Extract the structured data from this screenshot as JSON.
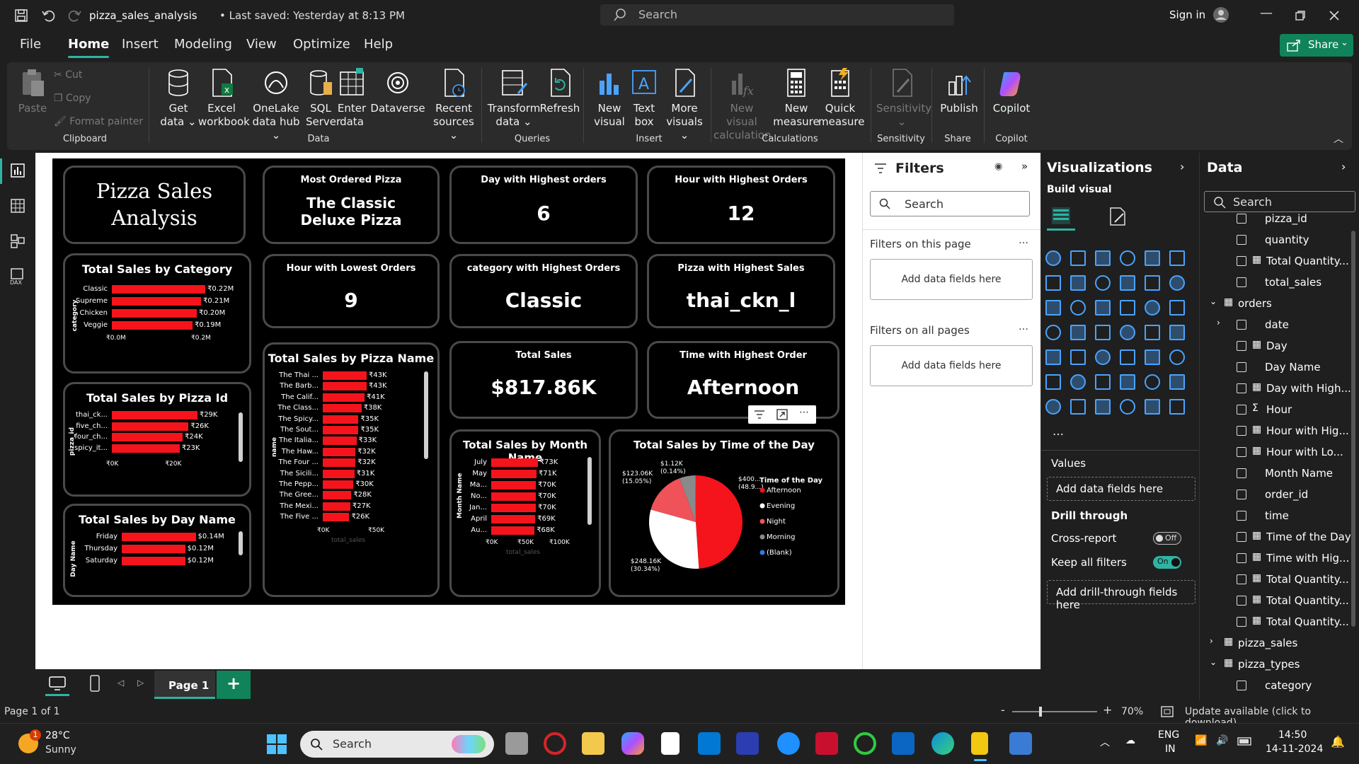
{
  "titlebar": {
    "filename": "pizza_sales_analysis",
    "saved": "• Last saved: Yesterday at 8:13 PM",
    "search_placeholder": "Search",
    "sign_in": "Sign in"
  },
  "menu": {
    "file": "File",
    "home": "Home",
    "insert": "Insert",
    "modeling": "Modeling",
    "view": "View",
    "optimize": "Optimize",
    "help": "Help",
    "share": "Share"
  },
  "ribbon": {
    "paste": "Paste",
    "cut": "Cut",
    "copy": "Copy",
    "format_painter": "Format painter",
    "clipboard": "Clipboard",
    "get_data_1": "Get",
    "get_data_2": "data",
    "excel_1": "Excel",
    "excel_2": "workbook",
    "onelake_1": "OneLake",
    "onelake_2": "data hub",
    "sql_1": "SQL",
    "sql_2": "Server",
    "enter_1": "Enter",
    "enter_2": "data",
    "dataverse": "Dataverse",
    "recent_1": "Recent",
    "recent_2": "sources",
    "data_group": "Data",
    "transform_1": "Transform",
    "transform_2": "data",
    "refresh": "Refresh",
    "queries_group": "Queries",
    "newvisual_1": "New",
    "newvisual_2": "visual",
    "textbox_1": "Text",
    "textbox_2": "box",
    "morevisuals_1": "More",
    "morevisuals_2": "visuals",
    "insert_group": "Insert",
    "nvc_1": "New visual",
    "nvc_2": "calculation",
    "nm_1": "New",
    "nm_2": "measure",
    "qm_1": "Quick",
    "qm_2": "measure",
    "calc_group": "Calculations",
    "sens": "Sensitivity",
    "sens_group": "Sensitivity",
    "publish": "Publish",
    "share_group": "Share",
    "copilot": "Copilot",
    "copilot_group": "Copilot"
  },
  "report": {
    "title": "Pizza Sales Analysis",
    "kpis": [
      {
        "title": "Most Ordered Pizza",
        "value": "The Classic Deluxe Pizza"
      },
      {
        "title": "Day with Highest orders",
        "value": "6"
      },
      {
        "title": "Hour with Highest Orders",
        "value": "12"
      },
      {
        "title": "Hour with Lowest Orders",
        "value": "9"
      },
      {
        "title": "category with Highest Orders",
        "value": "Classic"
      },
      {
        "title": "Pizza with Highest Sales",
        "value": "thai_ckn_l"
      },
      {
        "title": "Total Sales",
        "value": "$817.86K"
      },
      {
        "title": "Time with Highest Order",
        "value": "Afternoon"
      }
    ]
  },
  "chart_data": [
    {
      "type": "bar",
      "title": "Total Sales by Category",
      "ylabel": "category",
      "categories": [
        "Classic",
        "Supreme",
        "Chicken",
        "Veggie"
      ],
      "values": [
        0.22,
        0.21,
        0.2,
        0.19
      ],
      "labels": [
        "₹0.22M",
        "₹0.21M",
        "₹0.20M",
        "₹0.19M"
      ],
      "xticks": [
        "₹0.0M",
        "₹0.2M"
      ]
    },
    {
      "type": "bar",
      "title": "Total Sales by Pizza Id",
      "ylabel": "pizza_id",
      "categories": [
        "thai_ck...",
        "five_ch...",
        "four_ch...",
        "spicy_it..."
      ],
      "values": [
        29,
        26,
        24,
        23
      ],
      "labels": [
        "₹29K",
        "₹26K",
        "₹24K",
        "₹23K"
      ],
      "xticks": [
        "₹0K",
        "₹20K"
      ]
    },
    {
      "type": "bar",
      "title": "Total Sales by Day Name",
      "ylabel": "Day Name",
      "categories": [
        "Friday",
        "Thursday",
        "Saturday"
      ],
      "values": [
        0.14,
        0.12,
        0.12
      ],
      "labels": [
        "$0.14M",
        "$0.12M",
        "$0.12M"
      ]
    },
    {
      "type": "bar",
      "title": "Total Sales by Pizza Name",
      "ylabel": "name",
      "xlabel": "total_sales",
      "categories": [
        "The Thai ...",
        "The Barb...",
        "The Calif...",
        "The Class...",
        "The Spicy...",
        "The Sout...",
        "The Italia...",
        "The Haw...",
        "The Four ...",
        "The Sicili...",
        "The Pepp...",
        "The Gree...",
        "The Mexi...",
        "The Five ..."
      ],
      "values": [
        43,
        43,
        41,
        38,
        35,
        35,
        33,
        32,
        32,
        31,
        30,
        28,
        27,
        26
      ],
      "labels": [
        "₹43K",
        "₹43K",
        "₹41K",
        "₹38K",
        "₹35K",
        "₹35K",
        "₹33K",
        "₹32K",
        "₹32K",
        "₹31K",
        "₹30K",
        "₹28K",
        "₹27K",
        "₹26K"
      ],
      "xticks": [
        "₹0K",
        "₹50K"
      ]
    },
    {
      "type": "bar",
      "title": "Total Sales by Month Name",
      "ylabel": "Month Name",
      "xlabel": "total_sales",
      "categories": [
        "July",
        "May",
        "Ma...",
        "No...",
        "Jan...",
        "April",
        "Au..."
      ],
      "values": [
        73,
        71,
        70,
        70,
        70,
        69,
        68
      ],
      "labels": [
        "₹73K",
        "₹71K",
        "₹70K",
        "₹70K",
        "₹70K",
        "₹69K",
        "₹68K"
      ],
      "xticks": [
        "₹0K",
        "₹50K",
        "₹100K"
      ]
    },
    {
      "type": "pie",
      "title": "Total Sales by Time of the Day",
      "legend_title": "Time of the Day",
      "categories": [
        "Afternoon",
        "Evening",
        "Night",
        "Morning",
        "(Blank)"
      ],
      "values": [
        400,
        248.16,
        123.06,
        45,
        1.12
      ],
      "colors": [
        "#f5141c",
        "#ffffff",
        "#f0525a",
        "#8a8a8a",
        "#2b7de9"
      ],
      "slice_labels": [
        "$400...\n(48.9...)",
        "$248.16K\n(30.34%)",
        "$123.06K\n(15.05%)",
        "$1.12K\n(0.14%)"
      ]
    }
  ],
  "filters": {
    "title": "Filters",
    "search": "Search",
    "on_page": "Filters on this page",
    "all_pages": "Filters on all pages",
    "add": "Add data fields here"
  },
  "viz": {
    "title": "Visualizations",
    "build": "Build visual",
    "values": "Values",
    "add": "Add data fields here",
    "drill": "Drill through",
    "cross": "Cross-report",
    "cross_state": "Off",
    "keep": "Keep all filters",
    "keep_state": "On",
    "add_drill": "Add drill-through fields here"
  },
  "data": {
    "title": "Data",
    "search": "Search",
    "rows": [
      "pizza_id",
      "quantity",
      "Total Quantity...",
      "total_sales",
      "orders",
      "date",
      "Day",
      "Day Name",
      "Day with High...",
      "Hour",
      "Hour with Hig...",
      "Hour with Lo...",
      "Month Name",
      "order_id",
      "time",
      "Time of the Day",
      "Time with Hig...",
      "Total Quantity...",
      "Total Quantity...",
      "Total Quantity...",
      "pizza_sales",
      "pizza_types",
      "category"
    ]
  },
  "pages": {
    "page1": "Page 1"
  },
  "status": {
    "page": "Page 1 of 1",
    "zoom": "70%",
    "update": "Update available (click to download)"
  },
  "taskbar": {
    "temp": "28°C",
    "weather": "Sunny",
    "search": "Search",
    "lang1": "ENG",
    "lang2": "IN",
    "time": "14:50",
    "date": "14-11-2024",
    "notif": "1"
  }
}
